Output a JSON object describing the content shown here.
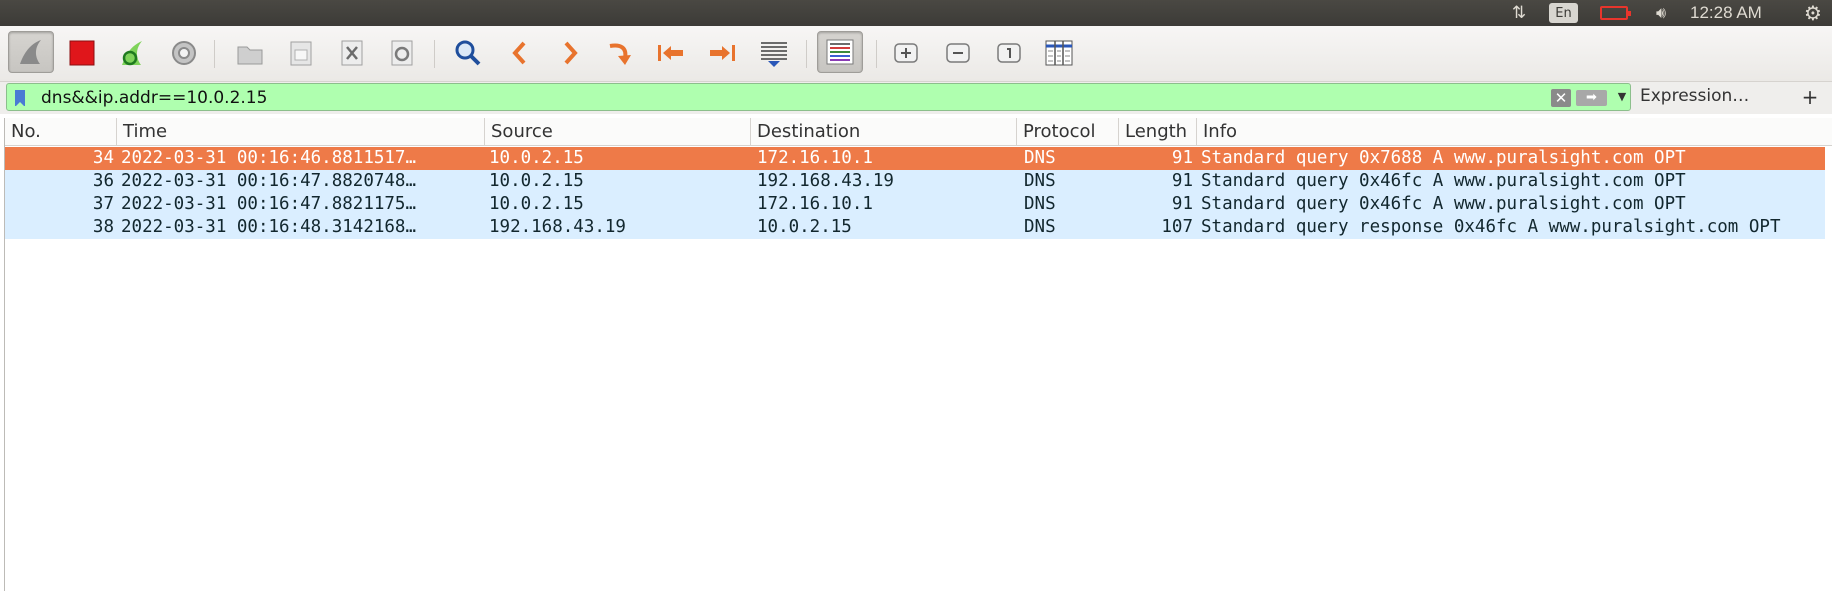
{
  "system": {
    "network_icon": "network-updown-icon",
    "language": "En",
    "battery_icon": "battery-low-icon",
    "volume_icon": "volume-icon",
    "time": "12:28 AM",
    "settings_icon": "system-gear-icon"
  },
  "toolbar": {
    "buttons": [
      {
        "name": "start-capture-button",
        "icon": "shark-fin-icon"
      },
      {
        "name": "stop-capture-button",
        "icon": "stop-square-icon"
      },
      {
        "name": "restart-capture-button",
        "icon": "restart-icon"
      },
      {
        "name": "capture-options-button",
        "icon": "gear-icon"
      },
      {
        "name": "open-file-button",
        "icon": "folder-icon"
      },
      {
        "name": "save-file-button",
        "icon": "save-icon"
      },
      {
        "name": "close-file-button",
        "icon": "close-file-icon"
      },
      {
        "name": "reload-file-button",
        "icon": "reload-icon"
      },
      {
        "name": "find-packet-button",
        "icon": "search-icon"
      },
      {
        "name": "go-back-button",
        "icon": "chevron-left-icon"
      },
      {
        "name": "go-forward-button",
        "icon": "chevron-right-icon"
      },
      {
        "name": "go-to-packet-button",
        "icon": "jump-icon"
      },
      {
        "name": "first-packet-button",
        "icon": "first-packet-icon"
      },
      {
        "name": "last-packet-button",
        "icon": "last-packet-icon"
      },
      {
        "name": "autoscroll-button",
        "icon": "autoscroll-icon"
      },
      {
        "name": "colorize-button",
        "icon": "colorize-icon"
      },
      {
        "name": "zoom-in-button",
        "icon": "zoom-in-icon"
      },
      {
        "name": "zoom-out-button",
        "icon": "zoom-out-icon"
      },
      {
        "name": "normal-size-button",
        "icon": "normal-size-icon"
      },
      {
        "name": "resize-columns-button",
        "icon": "resize-columns-icon"
      }
    ]
  },
  "filter": {
    "value": "dns&&ip.addr==10.0.2.15",
    "expression_label": "Expression…",
    "add_label": "+",
    "background": "#afffaf"
  },
  "packet_list": {
    "columns": [
      "No.",
      "Time",
      "Source",
      "Destination",
      "Protocol",
      "Length",
      "Info"
    ],
    "rows": [
      {
        "no": "34",
        "time": "2022-03-31 00:16:46.8811517…",
        "source": "10.0.2.15",
        "destination": "172.16.10.1",
        "protocol": "DNS",
        "length": "91",
        "info": "Standard query 0x7688 A www.puralsight.com OPT",
        "selected": true
      },
      {
        "no": "36",
        "time": "2022-03-31 00:16:47.8820748…",
        "source": "10.0.2.15",
        "destination": "192.168.43.19",
        "protocol": "DNS",
        "length": "91",
        "info": "Standard query 0x46fc A www.puralsight.com OPT",
        "selected": false
      },
      {
        "no": "37",
        "time": "2022-03-31 00:16:47.8821175…",
        "source": "10.0.2.15",
        "destination": "172.16.10.1",
        "protocol": "DNS",
        "length": "91",
        "info": "Standard query 0x46fc A www.puralsight.com OPT",
        "selected": false
      },
      {
        "no": "38",
        "time": "2022-03-31 00:16:48.3142168…",
        "source": "192.168.43.19",
        "destination": "10.0.2.15",
        "protocol": "DNS",
        "length": "107",
        "info": "Standard query response 0x46fc A www.puralsight.com OPT",
        "selected": false
      }
    ],
    "selected_color": "#ee7a48",
    "dns_row_color": "#daeeff"
  }
}
